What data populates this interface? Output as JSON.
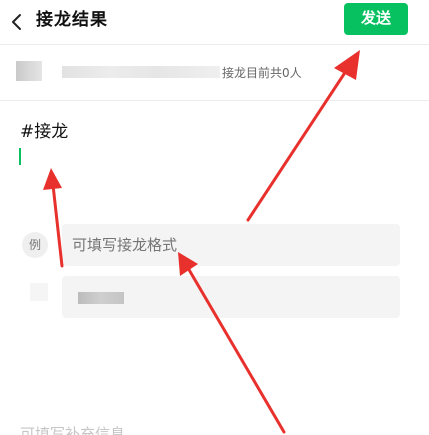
{
  "header": {
    "back_icon": "chevron-left-icon",
    "title": "接龙结果",
    "send_label": "发送"
  },
  "group": {
    "count_text": "接龙目前共0人"
  },
  "compose": {
    "text": "#接龙"
  },
  "example": {
    "badge": "例",
    "placeholder": "可填写接龙格式"
  },
  "supplement": {
    "placeholder": "可填写补充信息"
  },
  "colors": {
    "accent": "#07c160",
    "annotation_arrow": "#e8302c"
  }
}
